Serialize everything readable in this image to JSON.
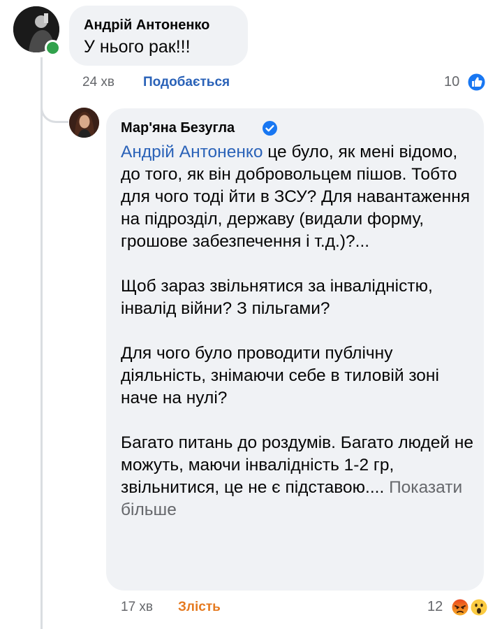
{
  "comment": {
    "author": "Андрій Антоненко",
    "text": "У нього рак!!!",
    "time": "24 хв",
    "like_label": "Подобається",
    "reaction_count": "10"
  },
  "reply": {
    "author": "Мар'яна Безугла",
    "mention": "Андрій Антоненко",
    "paragraph1_rest": " це було, як мені відомо, до того, як він добровольцем пішов. Тобто для чого тоді йти в ЗСУ? Для навантаження на підрозділ, державу (видали форму, грошове забезпечення і т.д.)?...",
    "paragraph2": "Щоб зараз звільнятися за інвалідністю, інвалід війни? З пільгами?",
    "paragraph3": "Для чого було проводити публічну діяльність, знімаючи себе в тиловій зоні наче на нулі?",
    "paragraph4": "Багато питань до роздумів. Багато людей не можуть, маючи інвалідність 1-2 гр, звільнитися, це не є підставою....",
    "see_more": " Показати більше",
    "time": "17 хв",
    "reaction_label": "Злість",
    "reaction_count": "12"
  },
  "colors": {
    "bubble": "#f0f2f5",
    "link": "#2a62b8",
    "angry_label": "#e57a20",
    "muted": "#65676b",
    "online": "#31a24c",
    "verified": "#1877f2"
  },
  "icons": {
    "verified": "verified-badge-icon",
    "like": "like-reaction-icon",
    "angry": "angry-reaction-icon",
    "wow": "wow-reaction-icon"
  }
}
